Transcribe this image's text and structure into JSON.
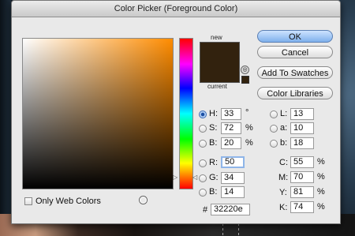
{
  "dialog": {
    "title": "Color Picker (Foreground Color)"
  },
  "swatch": {
    "new_label": "new",
    "current_label": "current",
    "color": "#32220e",
    "gamut_warning_icon": "alert-cube-icon"
  },
  "buttons": {
    "ok": "OK",
    "cancel": "Cancel",
    "add_to_swatches": "Add To Swatches",
    "color_libraries": "Color Libraries"
  },
  "hsb": {
    "h": {
      "label": "H:",
      "value": "33",
      "unit": "°"
    },
    "s": {
      "label": "S:",
      "value": "72",
      "unit": "%"
    },
    "b": {
      "label": "B:",
      "value": "20",
      "unit": "%"
    }
  },
  "rgb": {
    "r": {
      "label": "R:",
      "value": "50"
    },
    "g": {
      "label": "G:",
      "value": "34"
    },
    "b": {
      "label": "B:",
      "value": "14"
    }
  },
  "lab": {
    "l": {
      "label": "L:",
      "value": "13"
    },
    "a": {
      "label": "a:",
      "value": "10"
    },
    "b": {
      "label": "b:",
      "value": "18"
    }
  },
  "cmyk": {
    "c": {
      "label": "C:",
      "value": "55",
      "unit": "%"
    },
    "m": {
      "label": "M:",
      "value": "70",
      "unit": "%"
    },
    "y": {
      "label": "Y:",
      "value": "81",
      "unit": "%"
    },
    "k": {
      "label": "K:",
      "value": "74",
      "unit": "%"
    }
  },
  "hex": {
    "label": "#",
    "value": "32220e"
  },
  "web_colors": {
    "label": "Only Web Colors",
    "checked": false
  },
  "colors": {
    "ok_button": "#7fb0ec",
    "selected_radio": "#1c4fa3"
  }
}
